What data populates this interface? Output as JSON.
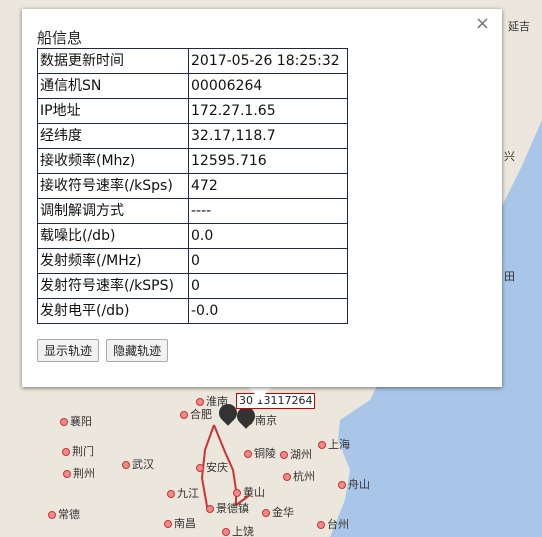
{
  "popup": {
    "title": "船信息",
    "close_glyph": "×",
    "rows": [
      {
        "label": "数据更新时间",
        "value": "2017-05-26 18:25:32"
      },
      {
        "label": "通信机SN",
        "value": "00006264"
      },
      {
        "label": "IP地址",
        "value": "172.27.1.65"
      },
      {
        "label": "经纬度",
        "value": "32.17,118.7"
      },
      {
        "label": "接收频率(Mhz)",
        "value": "12595.716"
      },
      {
        "label": "接收符号速率(/kSps)",
        "value": "472"
      },
      {
        "label": "调制解调方式",
        "value": "----"
      },
      {
        "label": "载噪比(/db)",
        "value": "0.0"
      },
      {
        "label": "发射频率(/MHz)",
        "value": "0"
      },
      {
        "label": "发射符号速率(/kSPS)",
        "value": "0"
      },
      {
        "label": "发射电平(/db)",
        "value": "-0.0"
      }
    ],
    "buttons": {
      "show_track": "显示轨迹",
      "hide_track": "隐藏轨迹"
    }
  },
  "map": {
    "ship_label": "30 13117264",
    "cities": {
      "hefei": "合肥",
      "nanjing": "南京",
      "huainan": "淮南",
      "shanghai": "上海",
      "huzhou": "湖州",
      "hangzhou": "杭州",
      "wuhan": "武汉",
      "anqing": "安庆",
      "tongling": "铜陵",
      "huangshan": "黄山",
      "jiujiang": "九江",
      "nanchang": "南昌",
      "jinhua": "金华",
      "zhoushan": "舟山",
      "taizhou": "台州",
      "xiangyang": "襄阳",
      "jingmen": "荆门",
      "jingzhou": "荆州",
      "changde": "常德",
      "shangrao": "上饶",
      "jingdezhen": "景德镇",
      "yanji": "延吉",
      "xing": "兴",
      "tian": "田"
    }
  }
}
